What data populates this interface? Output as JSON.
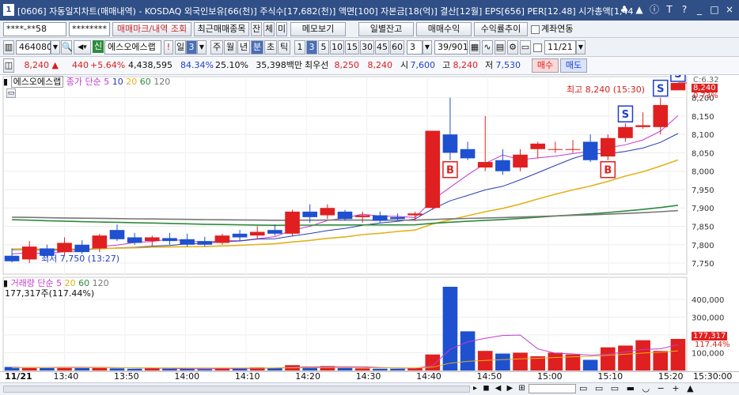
{
  "window": {
    "number": "1",
    "title": "[0606] 자동일지차트(매매내역) - KOSDAQ 외국인보유[66(천)] 주식수[17,682(천)] 액면[100] 자본금[18(억)] 결산[12월] EPS[656] PER[12.48] 시가총액[1,44",
    "controls": [
      "♣",
      "▲",
      "ⓘ",
      "T",
      "?",
      "_",
      "□",
      "×"
    ]
  },
  "toolbar1": {
    "account": "****-**58",
    "password": "********",
    "trade_mark_btn": "매매마크/내역 조회",
    "recent_btn": "최근매매종목",
    "jan": "잔",
    "che": "체",
    "mi": "미",
    "memo_btn": "메모보기",
    "daily_btn": "일별잔고",
    "profit_btn": "매매수익",
    "return_btn": "수익률추이",
    "link_label": "계좌연동"
  },
  "toolbar2": {
    "code": "464080",
    "stock_badge": "신",
    "stock_name": "에스오에스랩",
    "excl": "!",
    "period_sel": "일",
    "num_sel": "3",
    "periods": [
      "주",
      "월",
      "년",
      "분",
      "초",
      "틱"
    ],
    "minutes": [
      "1",
      "3",
      "5",
      "10",
      "15",
      "30",
      "45",
      "60"
    ],
    "count_sel": "3",
    "count": "39/901",
    "date": "11/21"
  },
  "quote": {
    "price": "8,240 ▲",
    "change": "440",
    "rate": "+5.64%",
    "volume": "4,438,595",
    "v1": "84.34%",
    "v2": "25.10%",
    "amount": "35,398백만",
    "pref_label": "최우선",
    "ask": "8,250",
    "bid": "8,240",
    "open_label": "시",
    "open": "7,600",
    "high_label": "고",
    "high": "8,240",
    "low_label": "저",
    "low": "7,530",
    "buy": "매수",
    "sell": "매도"
  },
  "price_panel": {
    "name": "에스오에스랩",
    "ma_label": "종가 단순",
    "ma": [
      "5",
      "10",
      "20",
      "60",
      "120"
    ],
    "ma_colors": [
      "#c23ad0",
      "#2a3cb0",
      "#e2b21b",
      "#2e8b3c",
      "#777777"
    ],
    "max_label": "최고 8,240 (15:30)",
    "min_label": "최저 7,750 (13:27)",
    "yaxis": [
      "8,200",
      "8,150",
      "8,100",
      "8,050",
      "8,000",
      "7,950",
      "7,900",
      "7,850",
      "7,800",
      "7,750"
    ],
    "ylim": [
      7720,
      8240
    ],
    "badges": [
      "C:6.32",
      "8,240",
      "0.73%"
    ]
  },
  "vol_panel": {
    "label": "거래량 단순",
    "ma": [
      "5",
      "20",
      "60",
      "120"
    ],
    "info": "177,317주(117.44%)",
    "yaxis": [
      "400,000",
      "300,000",
      "200,000",
      "100,000"
    ],
    "badges": [
      "177,317",
      "117.44%"
    ],
    "ylim": [
      0,
      470000
    ]
  },
  "xaxis": {
    "date": "11/21",
    "labels": [
      "13:40",
      "13:50",
      "14:00",
      "14:10",
      "14:20",
      "14:30",
      "14:40",
      "14:50",
      "15:00",
      "15:10",
      "15:20"
    ],
    "right": "15:30:00"
  },
  "chart_data": {
    "type": "candlestick",
    "candles": [
      {
        "o": 7770,
        "h": 7790,
        "l": 7752,
        "c": 7755
      },
      {
        "o": 7760,
        "h": 7810,
        "l": 7750,
        "c": 7795
      },
      {
        "o": 7790,
        "h": 7800,
        "l": 7765,
        "c": 7770
      },
      {
        "o": 7780,
        "h": 7820,
        "l": 7770,
        "c": 7805
      },
      {
        "o": 7800,
        "h": 7812,
        "l": 7775,
        "c": 7780
      },
      {
        "o": 7790,
        "h": 7830,
        "l": 7780,
        "c": 7825
      },
      {
        "o": 7840,
        "h": 7855,
        "l": 7810,
        "c": 7815
      },
      {
        "o": 7820,
        "h": 7832,
        "l": 7800,
        "c": 7805
      },
      {
        "o": 7810,
        "h": 7825,
        "l": 7795,
        "c": 7820
      },
      {
        "o": 7818,
        "h": 7832,
        "l": 7800,
        "c": 7810
      },
      {
        "o": 7815,
        "h": 7830,
        "l": 7795,
        "c": 7800
      },
      {
        "o": 7810,
        "h": 7822,
        "l": 7795,
        "c": 7800
      },
      {
        "o": 7805,
        "h": 7830,
        "l": 7800,
        "c": 7825
      },
      {
        "o": 7830,
        "h": 7840,
        "l": 7810,
        "c": 7820
      },
      {
        "o": 7825,
        "h": 7850,
        "l": 7815,
        "c": 7835
      },
      {
        "o": 7840,
        "h": 7855,
        "l": 7825,
        "c": 7830
      },
      {
        "o": 7830,
        "h": 7895,
        "l": 7825,
        "c": 7890
      },
      {
        "o": 7890,
        "h": 7910,
        "l": 7860,
        "c": 7875
      },
      {
        "o": 7880,
        "h": 7910,
        "l": 7870,
        "c": 7900
      },
      {
        "o": 7890,
        "h": 7895,
        "l": 7865,
        "c": 7870
      },
      {
        "o": 7875,
        "h": 7890,
        "l": 7860,
        "c": 7880
      },
      {
        "o": 7880,
        "h": 7890,
        "l": 7860,
        "c": 7865
      },
      {
        "o": 7875,
        "h": 7885,
        "l": 7865,
        "c": 7870
      },
      {
        "o": 7880,
        "h": 7890,
        "l": 7865,
        "c": 7885
      },
      {
        "o": 7900,
        "h": 8110,
        "l": 7895,
        "c": 8110
      },
      {
        "o": 8100,
        "h": 8200,
        "l": 8030,
        "c": 8050
      },
      {
        "o": 8060,
        "h": 8080,
        "l": 8030,
        "c": 8035
      },
      {
        "o": 8010,
        "h": 8150,
        "l": 8000,
        "c": 8025
      },
      {
        "o": 8030,
        "h": 8060,
        "l": 7990,
        "c": 8000
      },
      {
        "o": 8010,
        "h": 8060,
        "l": 8000,
        "c": 8045
      },
      {
        "o": 8060,
        "h": 8080,
        "l": 8035,
        "c": 8075
      },
      {
        "o": 8060,
        "h": 8080,
        "l": 8050,
        "c": 8060
      },
      {
        "o": 8060,
        "h": 8085,
        "l": 8050,
        "c": 8060
      },
      {
        "o": 8080,
        "h": 8100,
        "l": 8025,
        "c": 8030
      },
      {
        "o": 8040,
        "h": 8100,
        "l": 8030,
        "c": 8090
      },
      {
        "o": 8090,
        "h": 8130,
        "l": 8080,
        "c": 8120
      },
      {
        "o": 8120,
        "h": 8160,
        "l": 8115,
        "c": 8125
      },
      {
        "o": 8120,
        "h": 8200,
        "l": 8100,
        "c": 8180
      },
      {
        "o": 8220,
        "h": 8240,
        "l": 8220,
        "c": 8240
      }
    ],
    "volume": [
      20000,
      18000,
      15000,
      20000,
      15000,
      18000,
      12000,
      10000,
      12000,
      10000,
      10000,
      8000,
      15000,
      12000,
      18000,
      15000,
      30000,
      22000,
      25000,
      15000,
      12000,
      10000,
      10000,
      15000,
      90000,
      470000,
      220000,
      110000,
      95000,
      100000,
      80000,
      100000,
      90000,
      60000,
      130000,
      140000,
      170000,
      110000,
      177317
    ],
    "markers": [
      {
        "i": 25,
        "type": "B"
      },
      {
        "i": 34,
        "type": "B"
      },
      {
        "i": 35,
        "type": "S"
      },
      {
        "i": 37,
        "type": "S"
      },
      {
        "i": 38,
        "type": "S"
      }
    ]
  }
}
